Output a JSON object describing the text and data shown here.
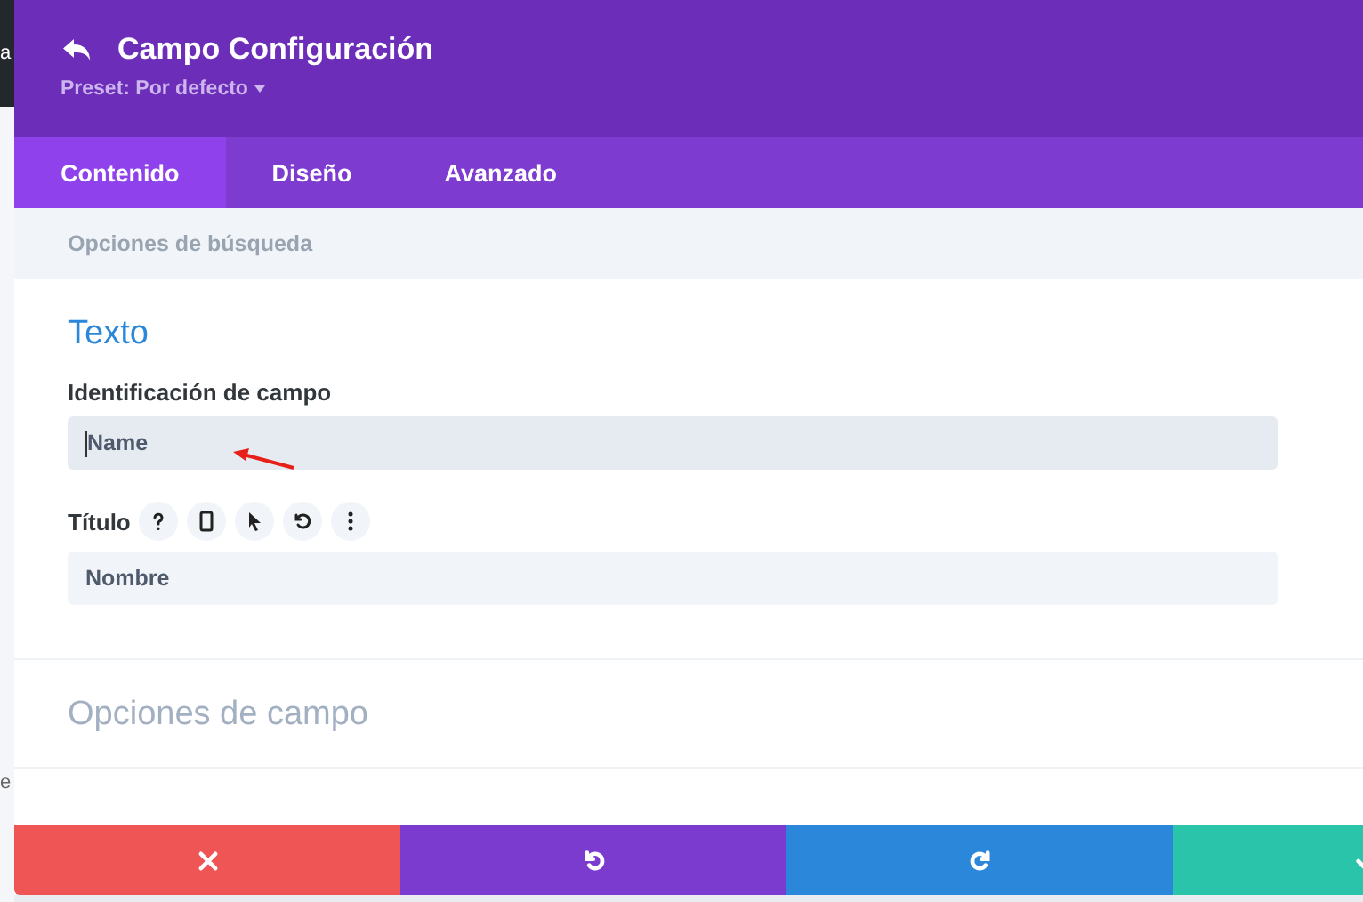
{
  "background_fragments": [
    "a",
    "e"
  ],
  "header": {
    "title": "Campo Configuración",
    "preset": "Preset: Por defecto"
  },
  "tabs": [
    {
      "label": "Contenido",
      "selected": true
    },
    {
      "label": "Diseño",
      "selected": false
    },
    {
      "label": "Avanzado",
      "selected": false
    }
  ],
  "search_hint": "Opciones de búsqueda",
  "section": {
    "title": "Texto",
    "expanded": true,
    "fields": [
      {
        "kind": "plain",
        "label": "Identificación de campo",
        "value": "Name",
        "focused": true
      },
      {
        "kind": "tools",
        "label": "Título",
        "value": "Nombre",
        "focused": false
      }
    ]
  },
  "collapsed_section": {
    "title": "Opciones de campo",
    "expanded": false
  },
  "footer": [
    {
      "kind": "cancel"
    },
    {
      "kind": "undo"
    },
    {
      "kind": "redo"
    },
    {
      "kind": "save"
    }
  ]
}
